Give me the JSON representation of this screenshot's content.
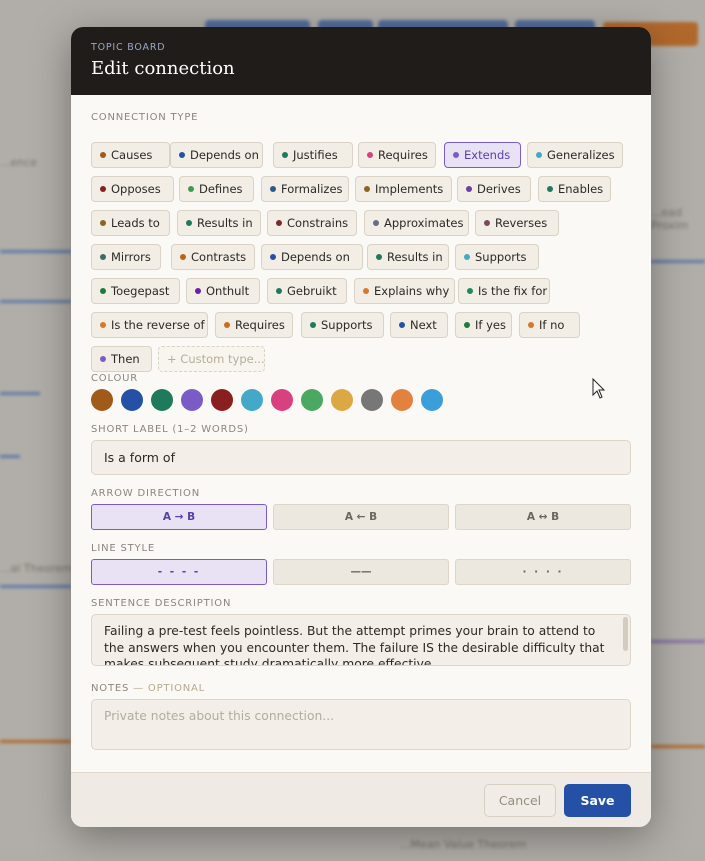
{
  "header": {
    "eyebrow": "TOPIC BOARD",
    "title": "Edit connection"
  },
  "connection_type": {
    "label": "CONNECTION TYPE",
    "selected": "Extends",
    "chips": [
      {
        "label": "Causes",
        "color": "#a05b1a"
      },
      {
        "label": "Depends on",
        "color": "#2451a6"
      },
      {
        "label": "Justifies",
        "color": "#1f7a5c"
      },
      {
        "label": "Requires",
        "color": "#d8417f"
      },
      {
        "label": "Extends",
        "color": "#7b5cc7"
      },
      {
        "label": "Generalizes",
        "color": "#44a9c8"
      },
      {
        "label": "Opposes",
        "color": "#8a1f1f"
      },
      {
        "label": "Defines",
        "color": "#3f9a4f"
      },
      {
        "label": "Formalizes",
        "color": "#2a5a8a"
      },
      {
        "label": "Implements",
        "color": "#8a6520"
      },
      {
        "label": "Derives",
        "color": "#6a3fa8"
      },
      {
        "label": "Enables",
        "color": "#1f7a5c"
      },
      {
        "label": "Leads to",
        "color": "#8a6520"
      },
      {
        "label": "Results in",
        "color": "#1f7a5c"
      },
      {
        "label": "Constrains",
        "color": "#7a2a2a"
      },
      {
        "label": "Approximates",
        "color": "#6a6a8a"
      },
      {
        "label": "Reverses",
        "color": "#7a4a5a"
      },
      {
        "label": "Mirrors",
        "color": "#3a6a6a"
      },
      {
        "label": "Contrasts",
        "color": "#b8651a"
      },
      {
        "label": "Depends on",
        "color": "#2451a6"
      },
      {
        "label": "Results in",
        "color": "#1f7a5c"
      },
      {
        "label": "Supports",
        "color": "#44a9c8"
      },
      {
        "label": "Toegepast",
        "color": "#1f7a3c"
      },
      {
        "label": "Onthult",
        "color": "#6a1fa8"
      },
      {
        "label": "Gebruikt",
        "color": "#1f7a5c"
      },
      {
        "label": "Explains why",
        "color": "#d8792a"
      },
      {
        "label": "Is the fix for",
        "color": "#1f8a5c"
      },
      {
        "label": "Is the reverse of",
        "color": "#d8792a"
      },
      {
        "label": "Requires",
        "color": "#c8701a"
      },
      {
        "label": "Supports",
        "color": "#1f7a5c"
      },
      {
        "label": "Next",
        "color": "#2451a6"
      },
      {
        "label": "If yes",
        "color": "#1f7a3c"
      },
      {
        "label": "If no",
        "color": "#d8792a"
      },
      {
        "label": "Then",
        "color": "#7b5cc7"
      }
    ],
    "custom_label": "+ Custom type..."
  },
  "colour": {
    "label": "COLOUR",
    "swatches": [
      "#a05b1a",
      "#2451a6",
      "#1f7a5c",
      "#7b5cc7",
      "#8a1f1f",
      "#44a9c8",
      "#d8417f",
      "#4aa860",
      "#dca844",
      "#777777",
      "#e2823e",
      "#3a9ed8"
    ]
  },
  "short_label": {
    "label": "SHORT LABEL (1–2 WORDS)",
    "value": "Is a form of"
  },
  "arrow_direction": {
    "label": "ARROW DIRECTION",
    "options": [
      "A → B",
      "A ← B",
      "A ↔ B"
    ],
    "selected": "A → B"
  },
  "line_style": {
    "label": "LINE STYLE",
    "options": [
      "- - - -",
      "——",
      "· · · ·"
    ],
    "selected": "- - - -"
  },
  "sentence": {
    "label": "SENTENCE DESCRIPTION",
    "value": "Failing a pre-test feels pointless. But the attempt primes your brain to attend to the answers when you encounter them. The failure IS the desirable difficulty that makes subsequent study dramatically more effective."
  },
  "notes": {
    "label": "NOTES",
    "optional": "— OPTIONAL",
    "placeholder": "Private notes about this connection..."
  },
  "footer": {
    "cancel": "Cancel",
    "save": "Save"
  },
  "background": {
    "texts": [
      "...ence",
      "...ead Proxim",
      "...al Theorem",
      "...Mean Value Theorem"
    ]
  }
}
